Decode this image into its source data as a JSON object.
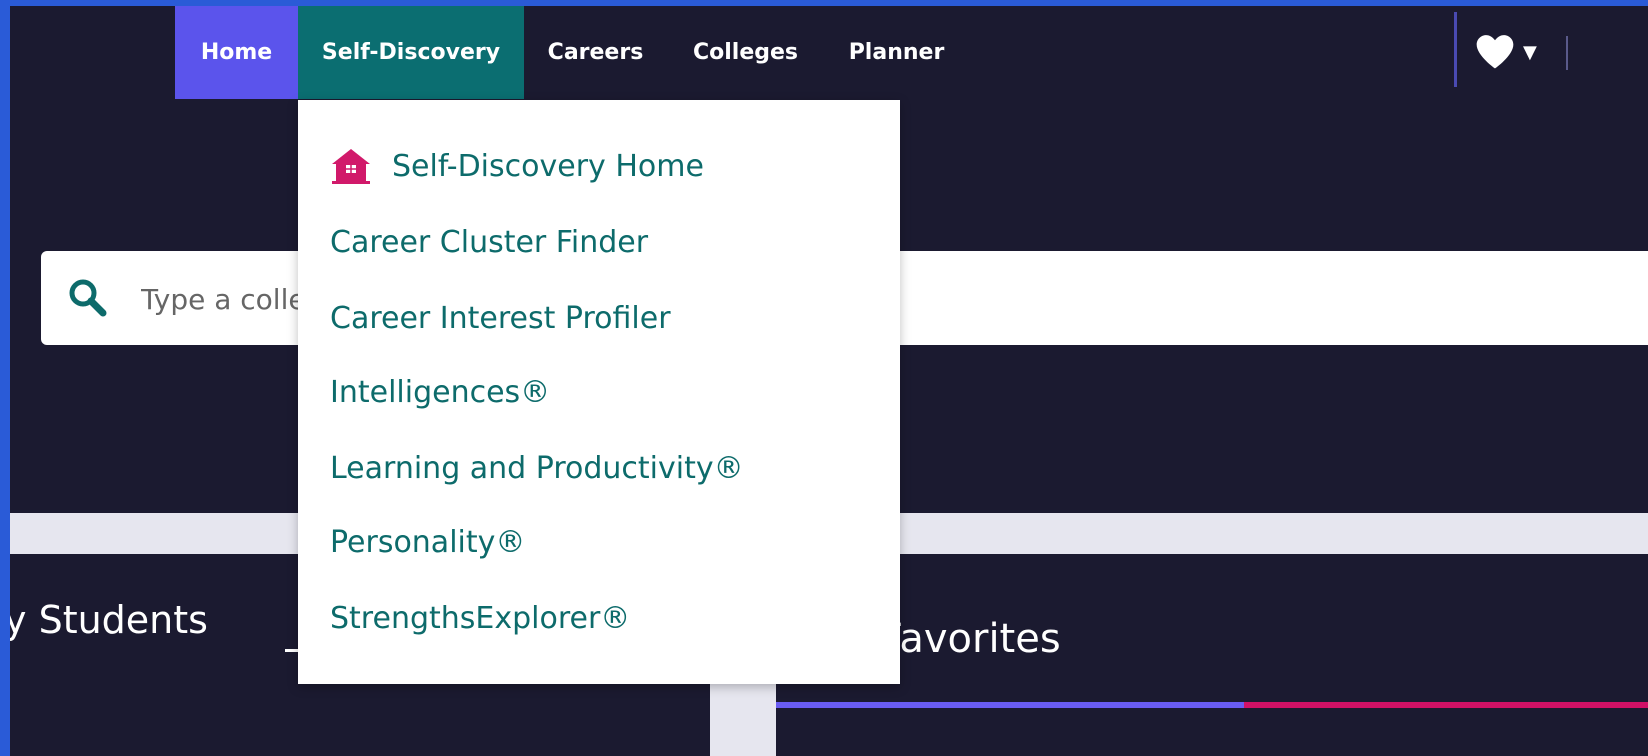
{
  "nav": {
    "items": [
      {
        "label": "Home",
        "bg": "#5b54ec"
      },
      {
        "label": "Self-Discovery",
        "bg": "#0b6e71"
      },
      {
        "label": "Careers"
      },
      {
        "label": "Colleges"
      },
      {
        "label": "Planner"
      }
    ],
    "favorites_icon": "heart-icon",
    "dropdown_caret": "▼"
  },
  "dropdown": {
    "items": [
      {
        "label": "Self-Discovery Home",
        "icon": "home-icon"
      },
      {
        "label": "Career Cluster Finder"
      },
      {
        "label": "Career Interest Profiler"
      },
      {
        "label": "Intelligences®"
      },
      {
        "label": "Learning and Productivity®"
      },
      {
        "label": "Personality®"
      },
      {
        "label": "StrengthsExplorer®"
      }
    ]
  },
  "search": {
    "placeholder": "Type a college name"
  },
  "sections": {
    "students_title": "y Students",
    "favorites_title": "Favorites"
  },
  "colors": {
    "page_bg": "#1b1a30",
    "frame": "#2a5bd7",
    "dropdown_text": "#0d6b6b",
    "home_icon": "#d1196a",
    "accent_purple": "#6a5cf2",
    "accent_pink": "#d11166"
  }
}
